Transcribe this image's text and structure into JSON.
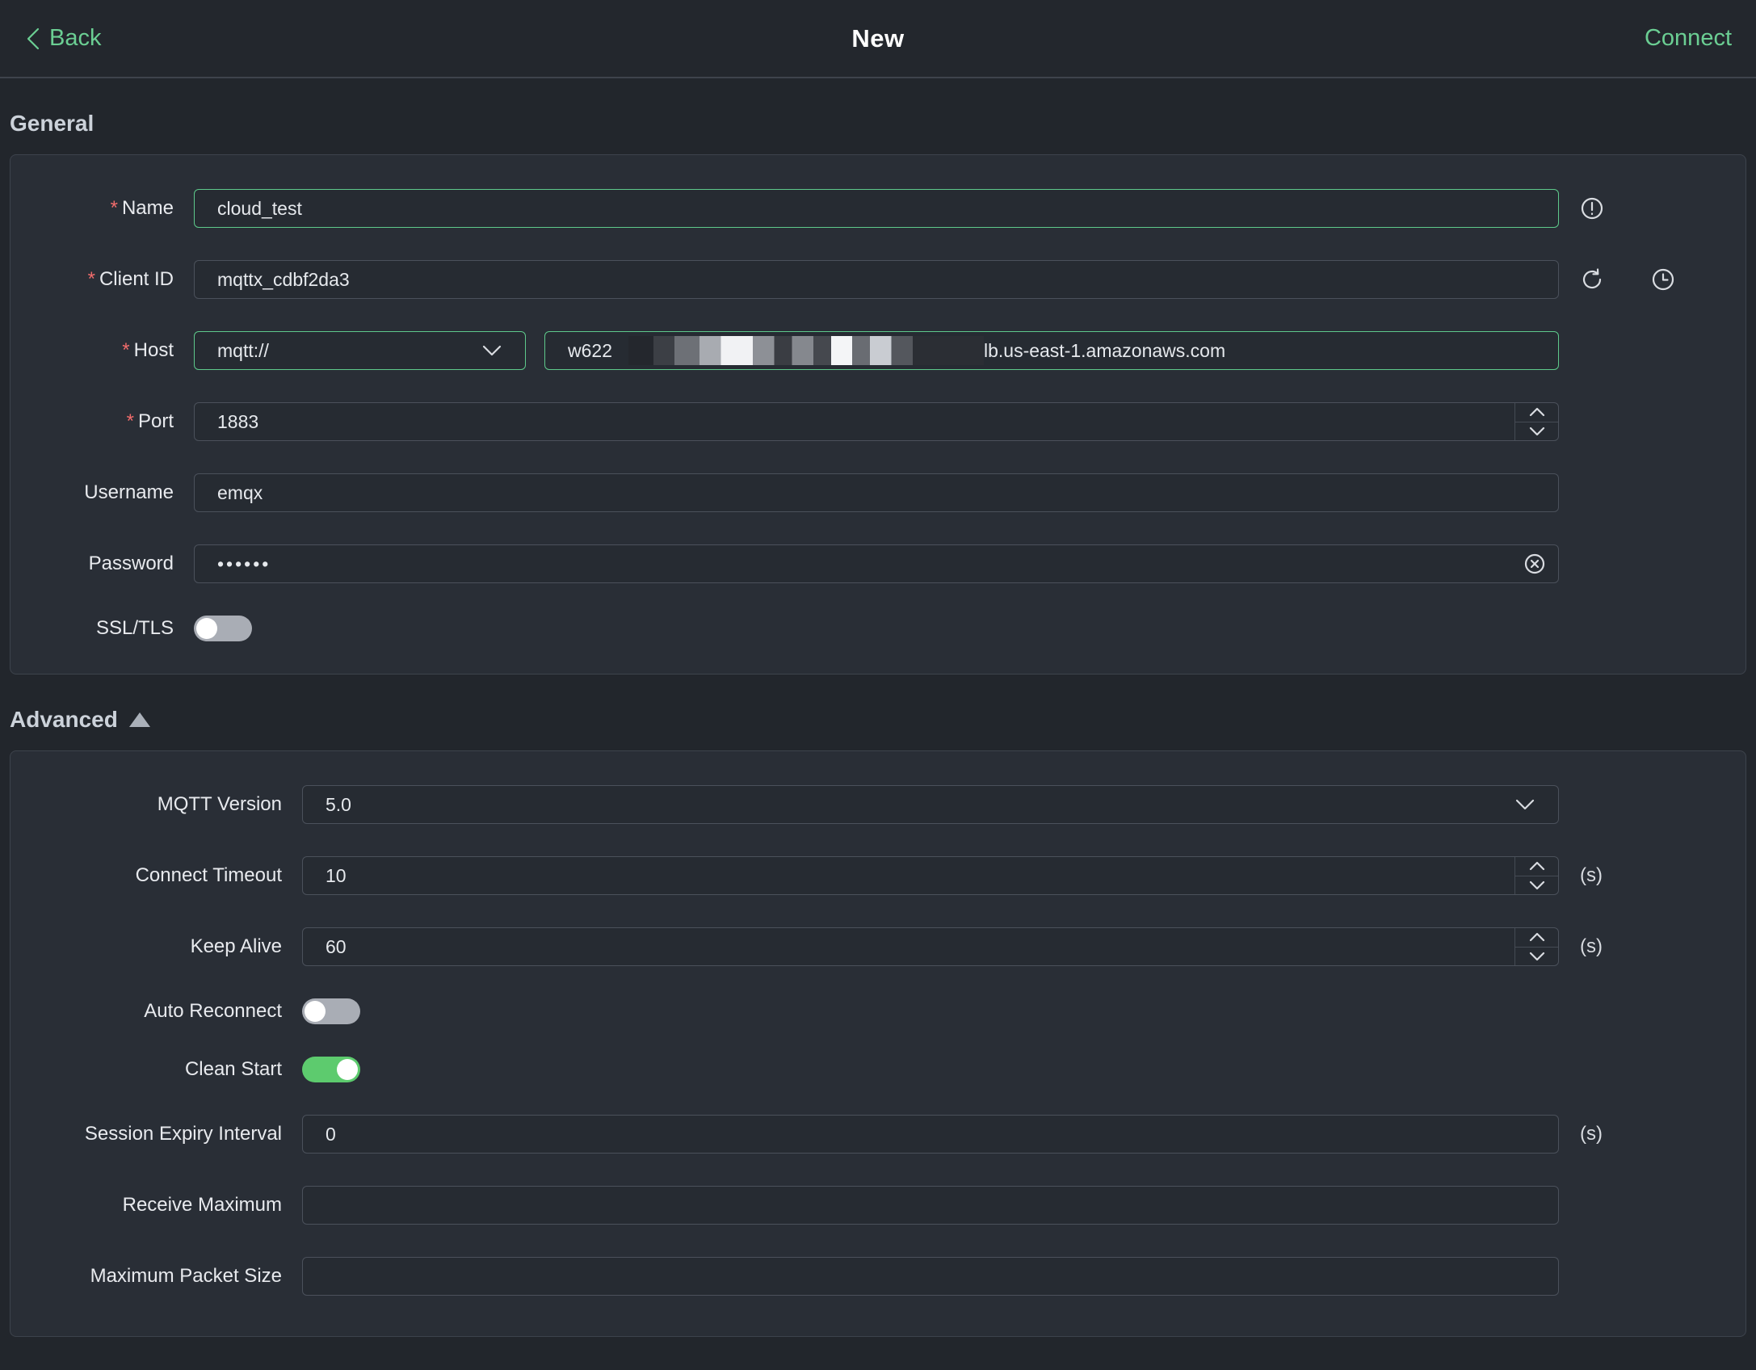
{
  "topbar": {
    "back_label": "Back",
    "title": "New",
    "connect_label": "Connect"
  },
  "ui": {
    "required_marker": "*"
  },
  "colors": {
    "accent_green": "#6bce93",
    "focus_border_green": "#5ec98b",
    "toggle_on_green": "#5dcb6e",
    "required_red": "#f16c6c",
    "page_bg": "#22262c",
    "card_bg": "#292e36"
  },
  "icons": {
    "back": "chevron-left-icon",
    "name_hint": "alert-circle-icon",
    "client_id_refresh": "refresh-icon",
    "client_id_history": "history-clock-icon",
    "password_clear": "x-circle-icon",
    "select_arrow": "chevron-down-icon",
    "spinner_up": "chevron-up-icon",
    "spinner_down": "chevron-down-icon",
    "advanced_collapse": "triangle-up-icon"
  },
  "sections": {
    "general": {
      "heading": "General",
      "fields": {
        "name": {
          "label": "Name",
          "required": true,
          "value": "cloud_test"
        },
        "client_id": {
          "label": "Client ID",
          "required": true,
          "value": "mqttx_cdbf2da3"
        },
        "host": {
          "label": "Host",
          "required": true,
          "protocol": "mqtt://",
          "value_prefix": "w622",
          "value_redacted": true,
          "value_suffix": "lb.us-east-1.amazonaws.com"
        },
        "port": {
          "label": "Port",
          "required": true,
          "value": "1883"
        },
        "username": {
          "label": "Username",
          "required": false,
          "value": "emqx"
        },
        "password": {
          "label": "Password",
          "required": false,
          "value": "••••••"
        },
        "ssl": {
          "label": "SSL/TLS",
          "enabled": false
        }
      }
    },
    "advanced": {
      "heading": "Advanced",
      "collapsed": false,
      "fields": {
        "mqtt_version": {
          "label": "MQTT Version",
          "value": "5.0"
        },
        "connect_timeout": {
          "label": "Connect Timeout",
          "value": "10",
          "suffix": "(s)"
        },
        "keep_alive": {
          "label": "Keep Alive",
          "value": "60",
          "suffix": "(s)"
        },
        "auto_reconnect": {
          "label": "Auto Reconnect",
          "enabled": false
        },
        "clean_start": {
          "label": "Clean Start",
          "enabled": true
        },
        "session_expiry": {
          "label": "Session Expiry Interval",
          "value": "0",
          "suffix": "(s)"
        },
        "receive_maximum": {
          "label": "Receive Maximum",
          "value": ""
        },
        "maximum_packet_size": {
          "label": "Maximum Packet Size",
          "value": ""
        }
      }
    }
  }
}
